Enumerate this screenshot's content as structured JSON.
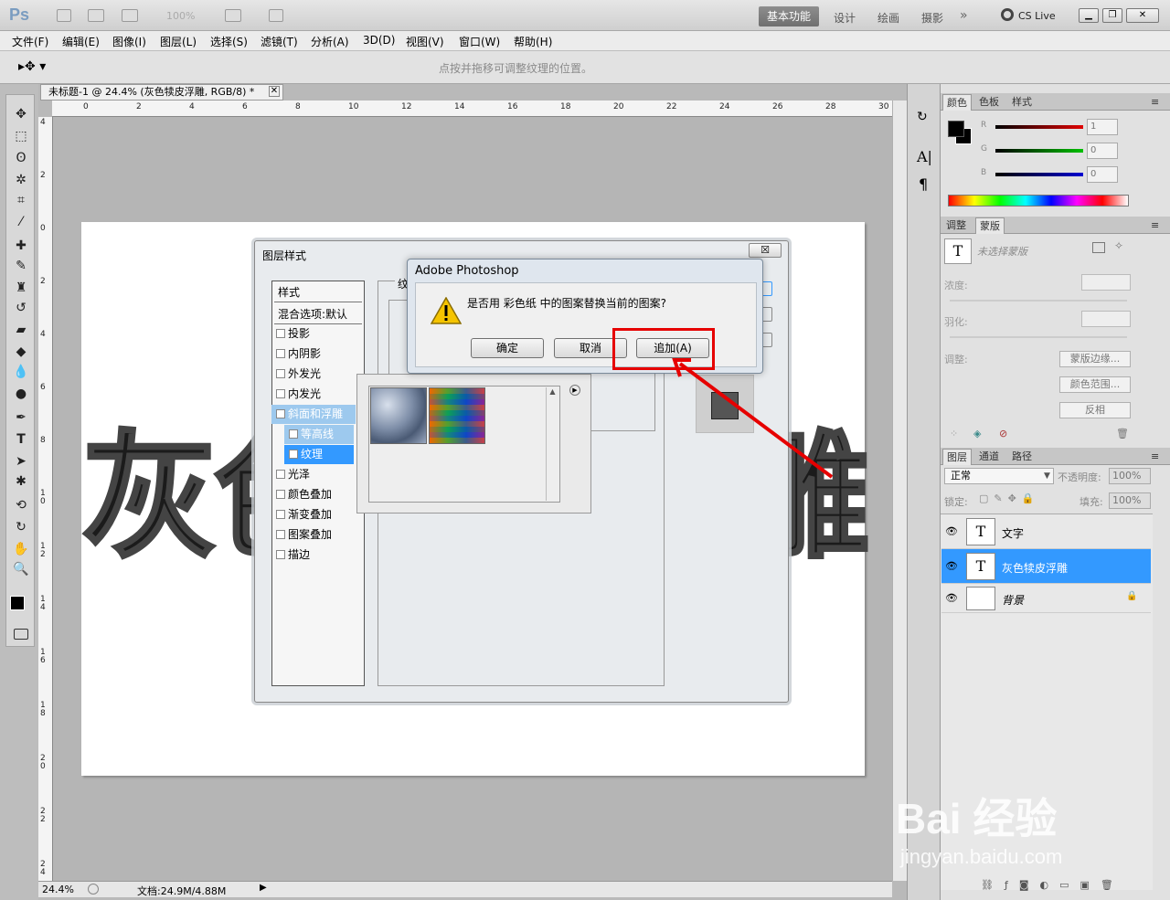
{
  "app": {
    "logo": "Ps",
    "zoom_combo": "100%",
    "workspaces": [
      "基本功能",
      "设计",
      "绘画",
      "摄影"
    ],
    "cs_live": "CS Live"
  },
  "menu": [
    "文件(F)",
    "编辑(E)",
    "图像(I)",
    "图层(L)",
    "选择(S)",
    "滤镜(T)",
    "分析(A)",
    "3D(D)",
    "视图(V)",
    "窗口(W)",
    "帮助(H)"
  ],
  "options": {
    "hint": "点按并拖移可调整纹理的位置。"
  },
  "document": {
    "tab_title": "未标题-1 @ 24.4% (灰色犊皮浮雕, RGB/8) *",
    "ruler_top": [
      "0",
      "2",
      "4",
      "6",
      "8",
      "10",
      "12",
      "14",
      "16",
      "18",
      "20",
      "22",
      "24",
      "26",
      "28",
      "30"
    ],
    "ruler_left": [
      "4",
      "2",
      "0",
      "2",
      "4",
      "6",
      "8",
      "1\n0",
      "1\n2",
      "1\n4",
      "1\n6",
      "1\n8",
      "2\n0",
      "2\n2",
      "2\n4"
    ],
    "canvas_text_left": "灰色",
    "canvas_text_right": "雕",
    "status_zoom": "24.4%",
    "status_doc": "文档:24.9M/4.88M"
  },
  "color_panel": {
    "tabs": [
      "颜色",
      "色板",
      "样式"
    ],
    "channels": [
      {
        "label": "R",
        "value": "1",
        "color": "#cc0000"
      },
      {
        "label": "G",
        "value": "0",
        "color": "#00b000"
      },
      {
        "label": "B",
        "value": "0",
        "color": "#0000cc"
      }
    ]
  },
  "adjust_panel": {
    "tabs": [
      "调整",
      "蒙版"
    ],
    "mask_status": "未选择蒙版",
    "density_label": "浓度:",
    "feather_label": "羽化:",
    "adjust_label": "调整:",
    "buttons": [
      "蒙版边缘...",
      "颜色范围...",
      "反相"
    ]
  },
  "layers_panel": {
    "tabs": [
      "图层",
      "通道",
      "路径"
    ],
    "blend_mode": "正常",
    "opacity_label": "不透明度:",
    "opacity": "100%",
    "lock_label": "锁定:",
    "fill_label": "填充:",
    "fill": "100%",
    "layers": [
      {
        "name": "文字",
        "thumb": "T",
        "selected": false
      },
      {
        "name": "灰色犊皮浮雕",
        "thumb": "T",
        "selected": true
      },
      {
        "name": "背景",
        "thumb": "",
        "selected": false
      }
    ]
  },
  "layer_style": {
    "title": "图层样式",
    "close": "☒",
    "styles_header": "样式",
    "blend_default": "混合选项:默认",
    "items": [
      {
        "label": "投影",
        "checked": false,
        "state": ""
      },
      {
        "label": "内阴影",
        "checked": false,
        "state": ""
      },
      {
        "label": "外发光",
        "checked": false,
        "state": ""
      },
      {
        "label": "内发光",
        "checked": false,
        "state": ""
      },
      {
        "label": "斜面和浮雕",
        "checked": true,
        "state": "semi"
      },
      {
        "label": "等高线",
        "checked": false,
        "state": "semi"
      },
      {
        "label": "纹理",
        "checked": true,
        "state": "sel"
      },
      {
        "label": "光泽",
        "checked": false,
        "state": ""
      },
      {
        "label": "颜色叠加",
        "checked": false,
        "state": ""
      },
      {
        "label": "渐变叠加",
        "checked": false,
        "state": ""
      },
      {
        "label": "图案叠加",
        "checked": false,
        "state": ""
      },
      {
        "label": "描边",
        "checked": false,
        "state": ""
      }
    ],
    "section_label": "纹"
  },
  "alert": {
    "title": "Adobe Photoshop",
    "message": "是否用 彩色纸 中的图案替换当前的图案?",
    "buttons": [
      "确定",
      "取消",
      "追加(A)"
    ]
  },
  "watermark": {
    "line1": "Bai 经验",
    "line2": "jingyan.baidu.com"
  }
}
